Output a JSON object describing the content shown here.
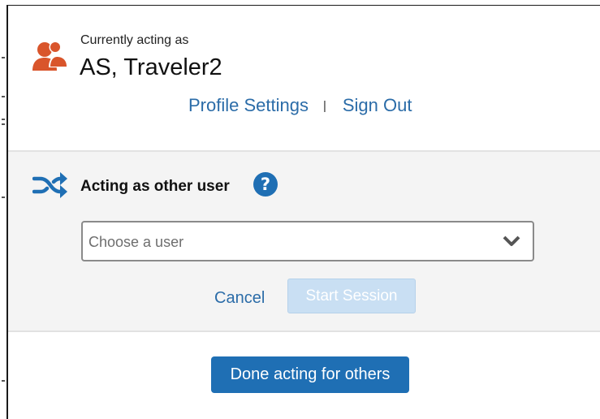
{
  "header": {
    "acting_label": "Currently acting as",
    "user_name": "AS, Traveler2",
    "profile_settings": "Profile Settings",
    "separator": "|",
    "sign_out": "Sign Out",
    "icon": "users-icon"
  },
  "acting_section": {
    "icon": "shuffle-icon",
    "title": "Acting as other user",
    "help_icon": "help-icon",
    "user_select": {
      "placeholder": "Choose a user",
      "value": ""
    },
    "cancel_label": "Cancel",
    "start_label": "Start Session",
    "start_enabled": false
  },
  "footer": {
    "done_label": "Done acting for others"
  },
  "colors": {
    "link": "#2b6ca8",
    "primary_button": "#1f6fb4",
    "disabled_button": "#c9dff3",
    "icon_orange": "#d9552b",
    "icon_blue": "#1f6fb4",
    "section_bg": "#f4f4f4"
  }
}
